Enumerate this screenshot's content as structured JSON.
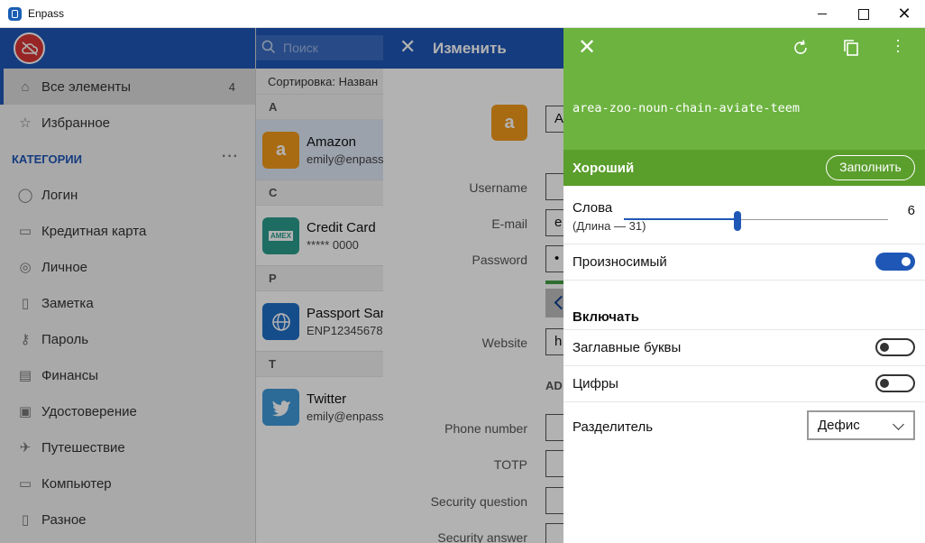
{
  "window": {
    "title": "Enpass"
  },
  "sidebar": {
    "all_items": {
      "label": "Все элементы",
      "count": "4"
    },
    "favorites": {
      "label": "Избранное"
    },
    "categories_header": "КАТЕГОРИИ",
    "categories": [
      {
        "label": "Логин",
        "icon": "globe-icon"
      },
      {
        "label": "Кредитная карта",
        "icon": "credit-card-icon"
      },
      {
        "label": "Личное",
        "icon": "person-icon"
      },
      {
        "label": "Заметка",
        "icon": "note-icon"
      },
      {
        "label": "Пароль",
        "icon": "key-icon"
      },
      {
        "label": "Финансы",
        "icon": "money-icon"
      },
      {
        "label": "Удостоверение",
        "icon": "id-card-icon"
      },
      {
        "label": "Путешествие",
        "icon": "plane-icon"
      },
      {
        "label": "Компьютер",
        "icon": "monitor-icon"
      },
      {
        "label": "Разное",
        "icon": "clipboard-icon"
      }
    ]
  },
  "list": {
    "search_placeholder": "Поиск",
    "sort_label": "Сортировка: Назван",
    "groups": [
      {
        "letter": "A",
        "title": "Amazon",
        "subtitle": "emily@enpass",
        "logo_text": "a",
        "color": "#f19a1a"
      },
      {
        "letter": "C",
        "title": "Credit Card",
        "subtitle": "***** 0000",
        "logo_text": "AMEX",
        "color": "#2a9d8f"
      },
      {
        "letter": "P",
        "title": "Passport San",
        "subtitle": "ENP12345678",
        "logo_text": "",
        "color": "#1f6fc6"
      },
      {
        "letter": "T",
        "title": "Twitter",
        "subtitle": "emily@enpass",
        "logo_text": "",
        "color": "#3f9ad8"
      }
    ]
  },
  "edit": {
    "title": "Изменить",
    "logo_text": "a",
    "title_field_value": "A",
    "fields": {
      "username": "Username",
      "email": "E-mail",
      "email_value": "e",
      "password": "Password",
      "password_value": "•",
      "website": "Website",
      "website_value": "h",
      "advanced": "AD",
      "phone": "Phone number",
      "totp": "TOTP",
      "security_question": "Security question",
      "security_answer": "Security answer"
    }
  },
  "generator": {
    "password": "area-zoo-noun-chain-aviate-teem",
    "strength": "Хороший",
    "fill_button": "Заполнить",
    "words_label": "Слова",
    "length_label": "(Длина — 31)",
    "words_value": "6",
    "words_slider_fraction": 0.43,
    "pronounceable_label": "Произносимый",
    "pronounceable_on": true,
    "include_header": "Включать",
    "uppercase_label": "Заглавные буквы",
    "uppercase_on": false,
    "digits_label": "Цифры",
    "digits_on": false,
    "separator_label": "Разделитель",
    "separator_value": "Дефис"
  },
  "colors": {
    "brand_blue": "#1f57b6",
    "generator_green": "#6cb33f",
    "strength_green": "#5a9e2c",
    "alert_red": "#d83535"
  }
}
